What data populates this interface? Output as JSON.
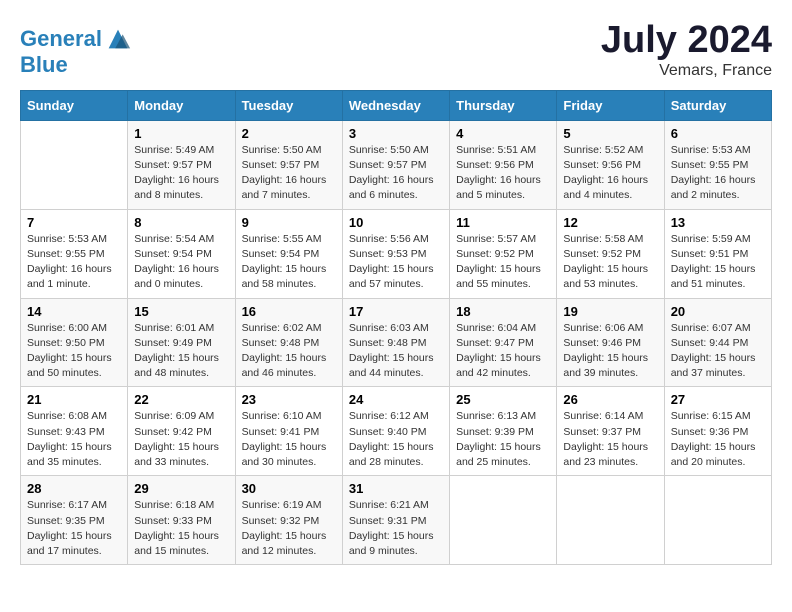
{
  "header": {
    "logo_line1": "General",
    "logo_line2": "Blue",
    "title": "July 2024",
    "subtitle": "Vemars, France"
  },
  "weekdays": [
    "Sunday",
    "Monday",
    "Tuesday",
    "Wednesday",
    "Thursday",
    "Friday",
    "Saturday"
  ],
  "weeks": [
    [
      {
        "day": "",
        "info": ""
      },
      {
        "day": "1",
        "info": "Sunrise: 5:49 AM\nSunset: 9:57 PM\nDaylight: 16 hours\nand 8 minutes."
      },
      {
        "day": "2",
        "info": "Sunrise: 5:50 AM\nSunset: 9:57 PM\nDaylight: 16 hours\nand 7 minutes."
      },
      {
        "day": "3",
        "info": "Sunrise: 5:50 AM\nSunset: 9:57 PM\nDaylight: 16 hours\nand 6 minutes."
      },
      {
        "day": "4",
        "info": "Sunrise: 5:51 AM\nSunset: 9:56 PM\nDaylight: 16 hours\nand 5 minutes."
      },
      {
        "day": "5",
        "info": "Sunrise: 5:52 AM\nSunset: 9:56 PM\nDaylight: 16 hours\nand 4 minutes."
      },
      {
        "day": "6",
        "info": "Sunrise: 5:53 AM\nSunset: 9:55 PM\nDaylight: 16 hours\nand 2 minutes."
      }
    ],
    [
      {
        "day": "7",
        "info": "Sunrise: 5:53 AM\nSunset: 9:55 PM\nDaylight: 16 hours\nand 1 minute."
      },
      {
        "day": "8",
        "info": "Sunrise: 5:54 AM\nSunset: 9:54 PM\nDaylight: 16 hours\nand 0 minutes."
      },
      {
        "day": "9",
        "info": "Sunrise: 5:55 AM\nSunset: 9:54 PM\nDaylight: 15 hours\nand 58 minutes."
      },
      {
        "day": "10",
        "info": "Sunrise: 5:56 AM\nSunset: 9:53 PM\nDaylight: 15 hours\nand 57 minutes."
      },
      {
        "day": "11",
        "info": "Sunrise: 5:57 AM\nSunset: 9:52 PM\nDaylight: 15 hours\nand 55 minutes."
      },
      {
        "day": "12",
        "info": "Sunrise: 5:58 AM\nSunset: 9:52 PM\nDaylight: 15 hours\nand 53 minutes."
      },
      {
        "day": "13",
        "info": "Sunrise: 5:59 AM\nSunset: 9:51 PM\nDaylight: 15 hours\nand 51 minutes."
      }
    ],
    [
      {
        "day": "14",
        "info": "Sunrise: 6:00 AM\nSunset: 9:50 PM\nDaylight: 15 hours\nand 50 minutes."
      },
      {
        "day": "15",
        "info": "Sunrise: 6:01 AM\nSunset: 9:49 PM\nDaylight: 15 hours\nand 48 minutes."
      },
      {
        "day": "16",
        "info": "Sunrise: 6:02 AM\nSunset: 9:48 PM\nDaylight: 15 hours\nand 46 minutes."
      },
      {
        "day": "17",
        "info": "Sunrise: 6:03 AM\nSunset: 9:48 PM\nDaylight: 15 hours\nand 44 minutes."
      },
      {
        "day": "18",
        "info": "Sunrise: 6:04 AM\nSunset: 9:47 PM\nDaylight: 15 hours\nand 42 minutes."
      },
      {
        "day": "19",
        "info": "Sunrise: 6:06 AM\nSunset: 9:46 PM\nDaylight: 15 hours\nand 39 minutes."
      },
      {
        "day": "20",
        "info": "Sunrise: 6:07 AM\nSunset: 9:44 PM\nDaylight: 15 hours\nand 37 minutes."
      }
    ],
    [
      {
        "day": "21",
        "info": "Sunrise: 6:08 AM\nSunset: 9:43 PM\nDaylight: 15 hours\nand 35 minutes."
      },
      {
        "day": "22",
        "info": "Sunrise: 6:09 AM\nSunset: 9:42 PM\nDaylight: 15 hours\nand 33 minutes."
      },
      {
        "day": "23",
        "info": "Sunrise: 6:10 AM\nSunset: 9:41 PM\nDaylight: 15 hours\nand 30 minutes."
      },
      {
        "day": "24",
        "info": "Sunrise: 6:12 AM\nSunset: 9:40 PM\nDaylight: 15 hours\nand 28 minutes."
      },
      {
        "day": "25",
        "info": "Sunrise: 6:13 AM\nSunset: 9:39 PM\nDaylight: 15 hours\nand 25 minutes."
      },
      {
        "day": "26",
        "info": "Sunrise: 6:14 AM\nSunset: 9:37 PM\nDaylight: 15 hours\nand 23 minutes."
      },
      {
        "day": "27",
        "info": "Sunrise: 6:15 AM\nSunset: 9:36 PM\nDaylight: 15 hours\nand 20 minutes."
      }
    ],
    [
      {
        "day": "28",
        "info": "Sunrise: 6:17 AM\nSunset: 9:35 PM\nDaylight: 15 hours\nand 17 minutes."
      },
      {
        "day": "29",
        "info": "Sunrise: 6:18 AM\nSunset: 9:33 PM\nDaylight: 15 hours\nand 15 minutes."
      },
      {
        "day": "30",
        "info": "Sunrise: 6:19 AM\nSunset: 9:32 PM\nDaylight: 15 hours\nand 12 minutes."
      },
      {
        "day": "31",
        "info": "Sunrise: 6:21 AM\nSunset: 9:31 PM\nDaylight: 15 hours\nand 9 minutes."
      },
      {
        "day": "",
        "info": ""
      },
      {
        "day": "",
        "info": ""
      },
      {
        "day": "",
        "info": ""
      }
    ]
  ]
}
